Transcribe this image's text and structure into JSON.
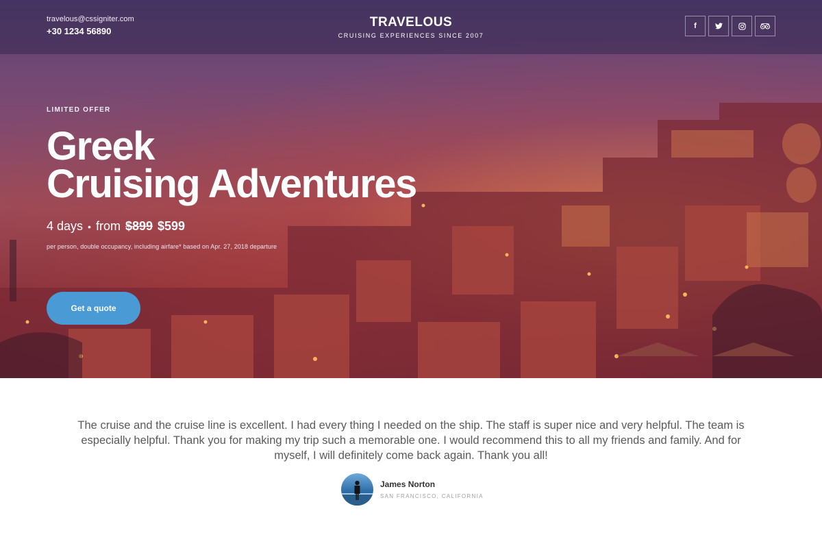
{
  "header": {
    "email": "travelous@cssigniter.com",
    "phone": "+30 1234 56890",
    "brand_name": "TRAVELOUS",
    "tagline": "CRUISING EXPERIENCES SINCE 2007",
    "social_links": [
      {
        "icon": "facebook-icon",
        "glyph": "f"
      },
      {
        "icon": "twitter-icon"
      },
      {
        "icon": "instagram-icon"
      },
      {
        "icon": "tripadvisor-icon"
      }
    ]
  },
  "hero": {
    "eyebrow": "LIMITED OFFER",
    "headline_line1": "Greek",
    "headline_line2": "Cruising Adventures",
    "duration": "4 days",
    "separator": "•",
    "from_label": "from",
    "old_price": "$899",
    "new_price": "$599",
    "fineprint": "per person, double occupancy, including airfare* based on Apr. 27, 2018 departure",
    "cta_label": "Get a quote",
    "cta_color": "#4a9ad6"
  },
  "testimonial": {
    "quote": "The cruise and the cruise line is excellent. I had every thing I needed on the ship. The staff is super nice and very helpful. The team is especially helpful. Thank you for making my trip such a memorable one. I would recommend this to all my friends and family. And for myself, I will definitely come back again. Thank you all!",
    "author_name": "James Norton",
    "author_location": "SAN FRANCISCO, CALIFORNIA"
  }
}
